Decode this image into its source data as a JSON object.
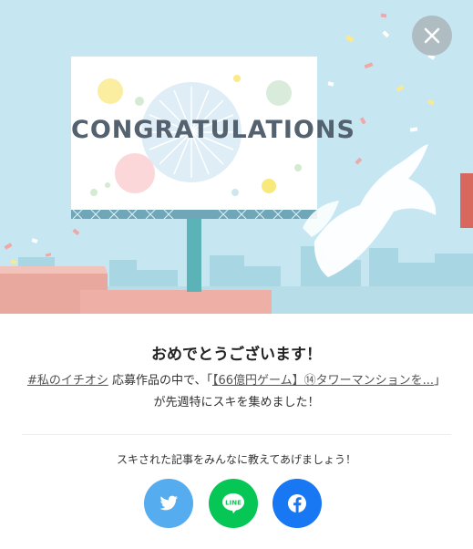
{
  "hero": {
    "billboard_text": "CONGRATULATIONS"
  },
  "close": {
    "icon": "close-icon"
  },
  "title": "おめでとうございます！",
  "message": {
    "hashtag": "#私のイチオシ",
    "part1": " 応募作品の中で、「",
    "article_link": "【66億円ゲーム】⑭タワーマンションを...",
    "part2": "」が先週特にスキを集めました！"
  },
  "share": {
    "prompt": "スキされた記事をみんなに教えてあげましょう！",
    "buttons": [
      {
        "name": "twitter",
        "icon": "twitter-icon",
        "color": "#55acee"
      },
      {
        "name": "line",
        "icon": "line-icon",
        "label": "LINE",
        "color": "#06c755"
      },
      {
        "name": "facebook",
        "icon": "facebook-icon",
        "color": "#1877f2"
      }
    ]
  }
}
